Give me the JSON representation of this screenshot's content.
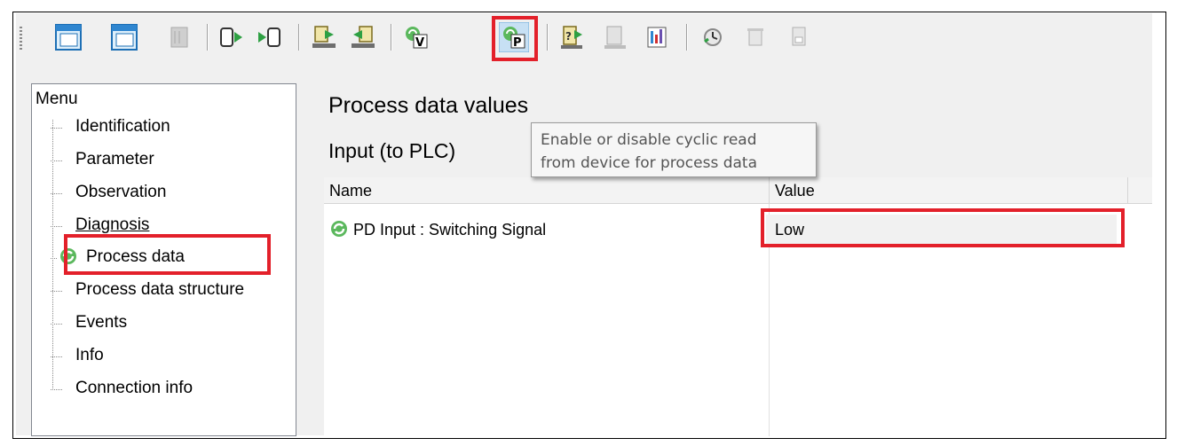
{
  "toolbar": {
    "buttons": [
      {
        "name": "layout-window-1-icon"
      },
      {
        "name": "layout-window-2-icon"
      },
      {
        "name": "disabled-panel-icon"
      },
      {
        "name": "connect-online-icon"
      },
      {
        "name": "disconnect-online-icon"
      },
      {
        "name": "upload-from-device-icon"
      },
      {
        "name": "download-to-device-icon"
      },
      {
        "name": "verify-values-icon"
      },
      {
        "name": "cyclic-process-data-icon"
      },
      {
        "name": "device-parameter-icon"
      },
      {
        "name": "compare-values-icon"
      },
      {
        "name": "observe-chart-icon"
      },
      {
        "name": "clock-refresh-icon"
      },
      {
        "name": "delete-icon"
      },
      {
        "name": "save-device-icon"
      }
    ],
    "accent_highlight": "#e3202a"
  },
  "menu": {
    "title": "Menu",
    "items": [
      {
        "label": "Identification"
      },
      {
        "label": "Parameter"
      },
      {
        "label": "Observation"
      },
      {
        "label": "Diagnosis"
      },
      {
        "label": "Process data"
      },
      {
        "label": "Process data structure"
      },
      {
        "label": "Events"
      },
      {
        "label": "Info"
      },
      {
        "label": "Connection info"
      }
    ]
  },
  "main": {
    "title": "Process data values",
    "subtitle": "Input (to PLC)",
    "tooltip": {
      "line1": "Enable or disable cyclic read",
      "line2": "from device for process data"
    },
    "table": {
      "columns": [
        "Name",
        "Value"
      ],
      "rows": [
        {
          "name": "PD Input : Switching Signal",
          "value": "Low"
        }
      ]
    }
  }
}
